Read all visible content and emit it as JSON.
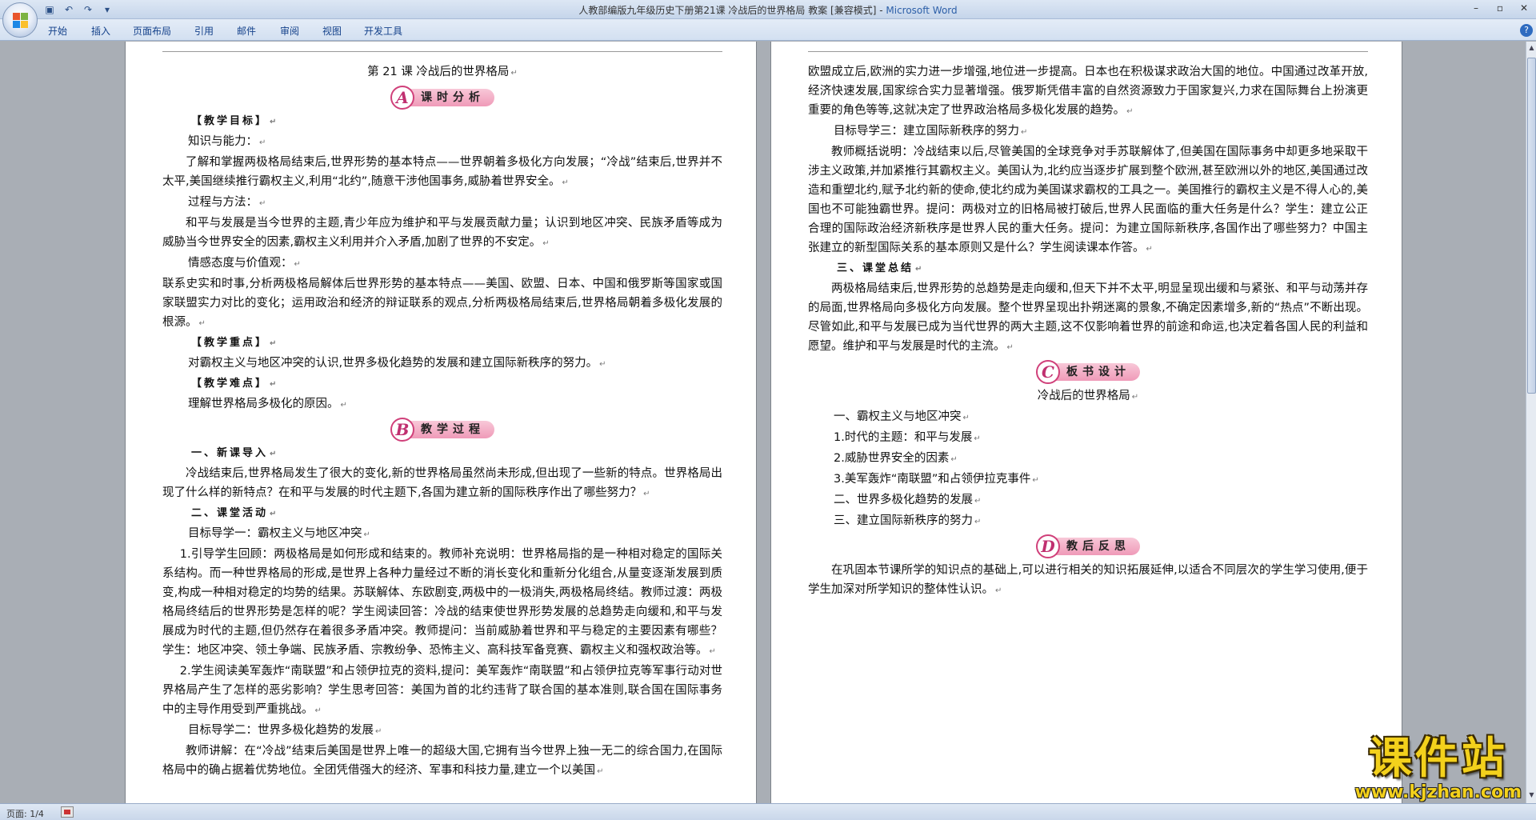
{
  "window": {
    "title": "人教部编版九年级历史下册第21课  冷战后的世界格局  教案 [兼容模式] - ",
    "app_name": "Microsoft Word"
  },
  "qat": [
    "save-icon",
    "undo-icon",
    "redo-icon",
    "customize-icon"
  ],
  "ribbon_tabs": [
    "开始",
    "插入",
    "页面布局",
    "引用",
    "邮件",
    "审阅",
    "视图",
    "开发工具"
  ],
  "help_label": "?",
  "page1": {
    "lesson_title": "第 21 课    冷战后的世界格局",
    "banner_a": {
      "letter": "A",
      "label": "课时分析"
    },
    "goals_head": "【教学目标】",
    "knowledge_head": "知识与能力：",
    "knowledge_text": "了解和掌握两极格局结束后,世界形势的基本特点——世界朝着多极化方向发展；“冷战”结束后,世界并不太平,美国继续推行霸权主义,利用“北约”,随意干涉他国事务,威胁着世界安全。",
    "process_head": "过程与方法：",
    "process_text": "和平与发展是当今世界的主题,青少年应为维护和平与发展贡献力量；认识到地区冲突、民族矛盾等成为威胁当今世界安全的因素,霸权主义利用并介入矛盾,加剧了世界的不安定。",
    "attitude_head": "情感态度与价值观：",
    "attitude_text": "联系史实和时事,分析两极格局解体后世界形势的基本特点——美国、欧盟、日本、中国和俄罗斯等国家或国家联盟实力对比的变化；运用政治和经济的辩证联系的观点,分析两极格局结束后,世界格局朝着多极化发展的根源。",
    "key_head": "【教学重点】",
    "key_text": "对霸权主义与地区冲突的认识,世界多极化趋势的发展和建立国际新秩序的努力。",
    "difficulty_head": "【教学难点】",
    "difficulty_text": "理解世界格局多极化的原因。",
    "banner_b": {
      "letter": "B",
      "label": "教学过程"
    },
    "intro_head": "一、新课导入",
    "intro_text": "冷战结束后,世界格局发生了很大的变化,新的世界格局虽然尚未形成,但出现了一些新的特点。世界格局出现了什么样的新特点？在和平与发展的时代主题下,各国为建立新的国际秩序作出了哪些努力？",
    "activity_head": "二、课堂活动",
    "guide1_head": "目标导学一：霸权主义与地区冲突",
    "guide1_p1": "1.引导学生回顾：两极格局是如何形成和结束的。教师补充说明：世界格局指的是一种相对稳定的国际关系结构。而一种世界格局的形成,是世界上各种力量经过不断的消长变化和重新分化组合,从量变逐渐发展到质变,构成一种相对稳定的均势的结果。苏联解体、东欧剧变,两极中的一极消失,两极格局终结。教师过渡：两极格局终结后的世界形势是怎样的呢？学生阅读回答：冷战的结束使世界形势发展的总趋势走向缓和,和平与发展成为时代的主题,但仍然存在着很多矛盾冲突。教师提问：当前威胁着世界和平与稳定的主要因素有哪些？学生：地区冲突、领土争端、民族矛盾、宗教纷争、恐怖主义、高科技军备竞赛、霸权主义和强权政治等。",
    "guide1_p2": "2.学生阅读美军轰炸“南联盟”和占领伊拉克的资料,提问：美军轰炸“南联盟”和占领伊拉克等军事行动对世界格局产生了怎样的恶劣影响？学生思考回答：美国为首的北约违背了联合国的基本准则,联合国在国际事务中的主导作用受到严重挑战。",
    "guide2_head": "目标导学二：世界多极化趋势的发展",
    "guide2_p1": "教师讲解：在“冷战”结束后美国是世界上唯一的超级大国,它拥有当今世界上独一无二的综合国力,在国际格局中的确占据着优势地位。全团凭借强大的经济、军事和科技力量,建立一个以美国"
  },
  "page2": {
    "cont_text": "欧盟成立后,欧洲的实力进一步增强,地位进一步提高。日本也在积极谋求政治大国的地位。中国通过改革开放,经济快速发展,国家综合实力显著增强。俄罗斯凭借丰富的自然资源致力于国家复兴,力求在国际舞台上扮演更重要的角色等等,这就决定了世界政治格局多极化发展的趋势。",
    "guide3_head": "目标导学三：建立国际新秩序的努力",
    "guide3_text": "教师概括说明：冷战结束以后,尽管美国的全球竞争对手苏联解体了,但美国在国际事务中却更多地采取干涉主义政策,并加紧推行其霸权主义。美国认为,北约应当逐步扩展到整个欧洲,甚至欧洲以外的地区,美国通过改造和重塑北约,赋予北约新的使命,使北约成为美国谋求霸权的工具之一。美国推行的霸权主义是不得人心的,美国也不可能独霸世界。提问：两极对立的旧格局被打破后,世界人民面临的重大任务是什么？学生：建立公正合理的国际政治经济新秩序是世界人民的重大任务。提问：为建立国际新秩序,各国作出了哪些努力？中国主张建立的新型国际关系的基本原则又是什么？学生阅读课本作答。",
    "summary_head": "三、课堂总结",
    "summary_text": "两极格局结束后,世界形势的总趋势是走向缓和,但天下并不太平,明显呈现出缓和与紧张、和平与动荡并存的局面,世界格局向多极化方向发展。整个世界呈现出扑朔迷离的景象,不确定因素增多,新的“热点”不断出现。尽管如此,和平与发展已成为当代世界的两大主题,这不仅影响着世界的前途和命运,也决定着各国人民的利益和愿望。维护和平与发展是时代的主流。",
    "banner_c": {
      "letter": "C",
      "label": "板书设计"
    },
    "board_title": "冷战后的世界格局",
    "board_items": [
      "一、霸权主义与地区冲突",
      "1.时代的主题：和平与发展",
      "2.威胁世界安全的因素",
      "3.美军轰炸“南联盟”和占领伊拉克事件",
      "二、世界多极化趋势的发展",
      "三、建立国际新秩序的努力"
    ],
    "banner_d": {
      "letter": "D",
      "label": "教后反思"
    },
    "reflection_text": "在巩固本节课所学的知识点的基础上,可以进行相关的知识拓展延伸,以适合不同层次的学生学习使用,便于学生加深对所学知识的整体性认识。"
  },
  "status": {
    "page": "页面: 1/4"
  },
  "watermark": {
    "title": "课件站",
    "url": "www.kjzhan.com"
  },
  "para_mark": "↵"
}
